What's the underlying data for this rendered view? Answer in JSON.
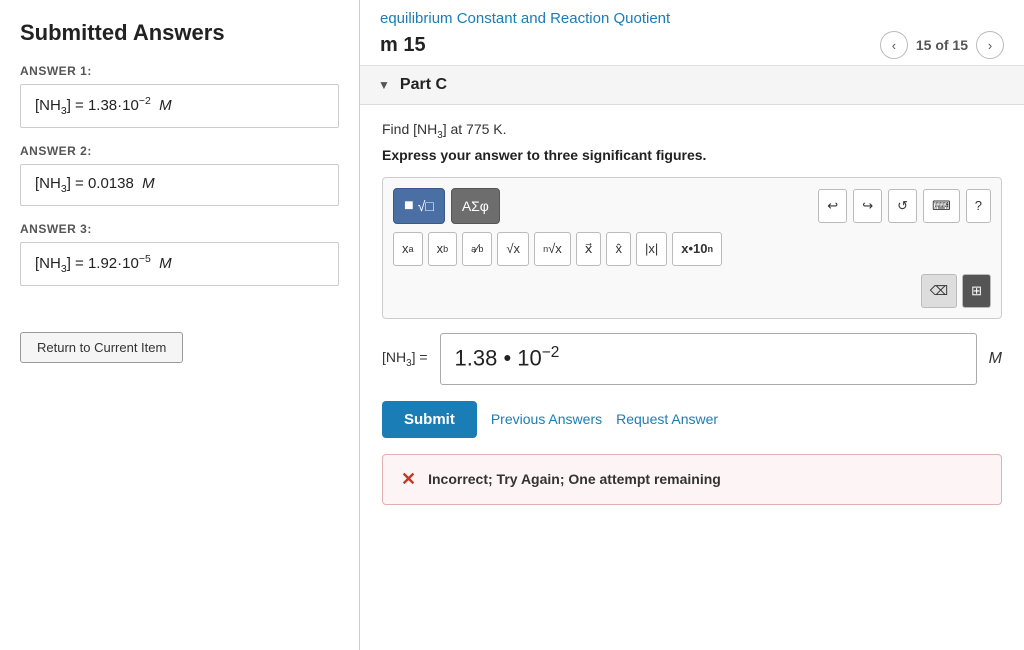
{
  "left": {
    "title": "Submitted Answers",
    "answers": [
      {
        "label": "ANSWER 1:",
        "value": "[NH₃] = 1.38·10⁻² M",
        "display": "[NH₃] = 1.38·10⁻²  M"
      },
      {
        "label": "ANSWER 2:",
        "value": "[NH₃] = 0.0138 M",
        "display": "[NH₃] = 0.0138  M"
      },
      {
        "label": "ANSWER 3:",
        "value": "[NH₃] = 1.92·10⁻⁵ M",
        "display": "[NH₃] = 1.92·10⁻⁵  M"
      }
    ],
    "return_button": "Return to Current Item"
  },
  "right": {
    "topic": "equilibrium Constant and Reaction Quotient",
    "item_label": "m 15",
    "pagination": "15 of 15",
    "nav_prev": "<",
    "nav_next": ">",
    "part": "Part C",
    "question_text": "Find [NH₃] at 775 K.",
    "question_instruction": "Express your answer to three significant figures.",
    "toolbar": {
      "btn_math_label": "√□",
      "btn_greek_label": "ΑΣφ",
      "btn_undo": "↩",
      "btn_redo": "↪",
      "btn_reset": "↺",
      "btn_keyboard": "⌨",
      "btn_help": "?",
      "btn_xa": "xᵃ",
      "btn_xb": "x_b",
      "btn_ab": "a/b",
      "btn_sqrt": "√x",
      "btn_nthrt": "ⁿ√x",
      "btn_vec": "x→",
      "btn_hat": "x̂",
      "btn_abs": "|x|",
      "btn_sci": "x•10ⁿ",
      "btn_backspace": "⌫",
      "btn_keypad": "⊞"
    },
    "formula_label": "[NH₃] =",
    "formula_value": "1.38 • 10⁻²",
    "formula_unit": "M",
    "submit_label": "Submit",
    "prev_answers_label": "Previous Answers",
    "request_answer_label": "Request Answer",
    "error": {
      "icon": "✕",
      "text": "Incorrect; Try Again; One attempt remaining"
    }
  }
}
